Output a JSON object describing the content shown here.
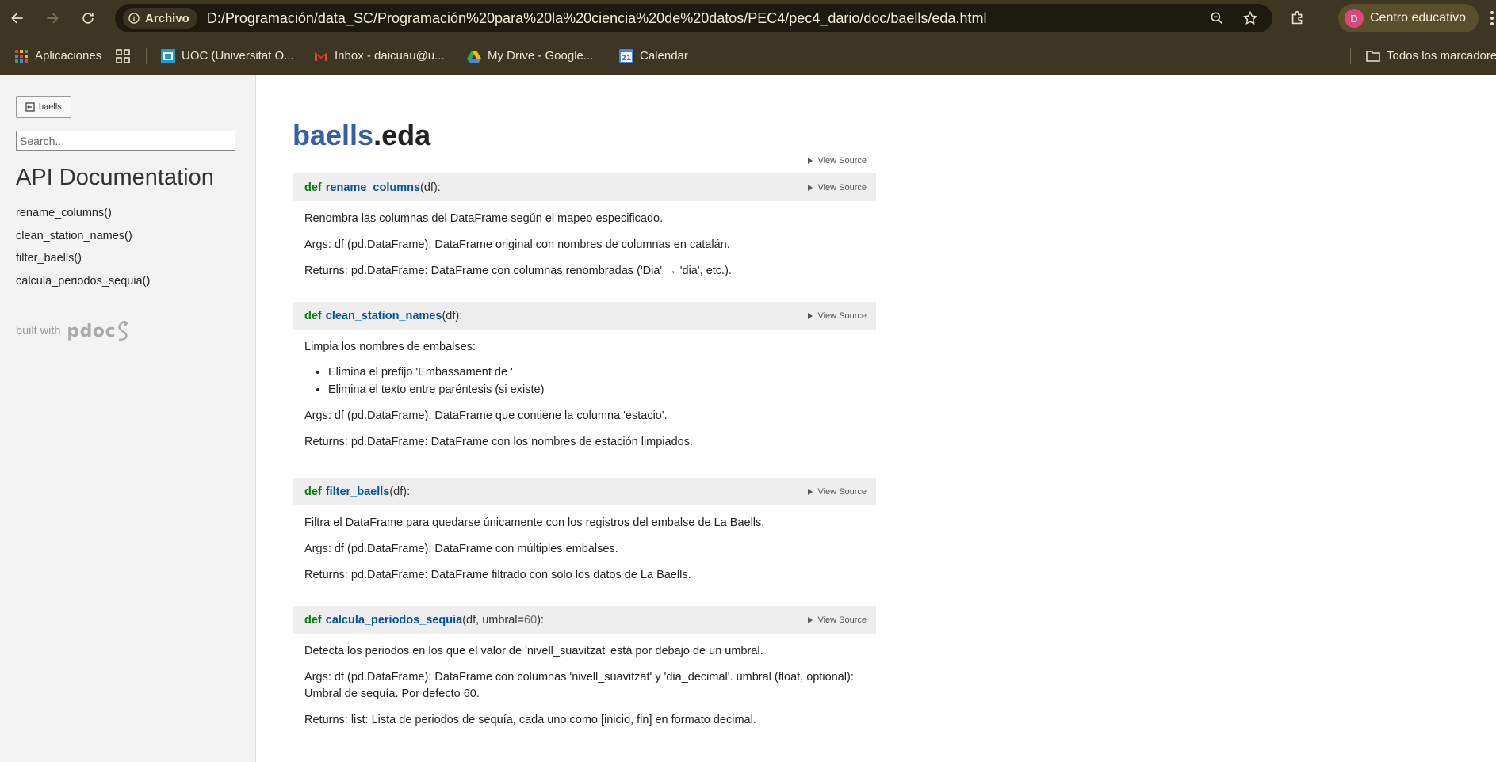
{
  "browser": {
    "chip_label": "Archivo",
    "url": "D:/Programación/data_SC/Programación%20para%20la%20ciencia%20de%20datos/PEC4/pec4_dario/doc/baells/eda.html",
    "profile_label": "Centro educativo",
    "profile_initial": "D",
    "bookmarks": [
      {
        "label": "Aplicaciones",
        "icon": "apps-grid-icon"
      },
      {
        "label": "UOC (Universitat O...",
        "icon": "uoc-icon"
      },
      {
        "label": "Inbox - daicuau@u...",
        "icon": "gmail-icon"
      },
      {
        "label": "My Drive - Google...",
        "icon": "drive-icon"
      },
      {
        "label": "Calendar",
        "icon": "calendar-icon",
        "day": "21"
      }
    ],
    "all_bookmarks_label": "Todos los marcadores"
  },
  "sidebar": {
    "module_button": "baells",
    "search_placeholder": "Search...",
    "title": "API Documentation",
    "items": [
      "rename_columns()",
      "clean_station_names()",
      "filter_baells()",
      "calcula_periodos_sequia()"
    ],
    "built_with": "built with",
    "logo_text": "pdoc"
  },
  "content": {
    "package": "baells",
    "module": ".eda",
    "view_source": "View Source",
    "functions": [
      {
        "keyword": "def",
        "name": "rename_columns",
        "params": "(df):",
        "paragraphs_before": [
          "Renombra las columnas del DataFrame según el mapeo especificado."
        ],
        "bullets": [],
        "paragraphs": [
          "Args: df (pd.DataFrame): DataFrame original con nombres de columnas en catalán.",
          "Returns: pd.DataFrame: DataFrame con columnas renombradas ('Dia' → 'dia', etc.)."
        ]
      },
      {
        "keyword": "def",
        "name": "clean_station_names",
        "params": "(df):",
        "paragraphs_before": [
          "Limpia los nombres de embalses:"
        ],
        "bullets": [
          "Elimina el prefijo 'Embassament de '",
          "Elimina el texto entre paréntesis (si existe)"
        ],
        "paragraphs": [
          "Args: df (pd.DataFrame): DataFrame que contiene la columna 'estacio'.",
          "Returns: pd.DataFrame: DataFrame con los nombres de estación limpiados."
        ]
      },
      {
        "keyword": "def",
        "name": "filter_baells",
        "params": "(df):",
        "paragraphs_before": [
          "Filtra el DataFrame para quedarse únicamente con los registros del embalse de La Baells."
        ],
        "bullets": [],
        "paragraphs": [
          "Args: df (pd.DataFrame): DataFrame con múltiples embalses.",
          "Returns: pd.DataFrame: DataFrame filtrado con solo los datos de La Baells."
        ]
      },
      {
        "keyword": "def",
        "name": "calcula_periodos_sequia",
        "params_a": "(df, umbral=",
        "params_num": "60",
        "params_b": "):",
        "paragraphs_before": [
          "Detecta los periodos en los que el valor de 'nivell_suavitzat' está por debajo de un umbral."
        ],
        "bullets": [],
        "paragraphs": [
          "Args: df (pd.DataFrame): DataFrame con columnas 'nivell_suavitzat' y 'dia_decimal'. umbral (float, optional): Umbral de sequía. Por defecto 60.",
          "Returns: list: Lista de periodos de sequía, cada uno como [inicio, fin] en formato decimal."
        ]
      }
    ]
  }
}
